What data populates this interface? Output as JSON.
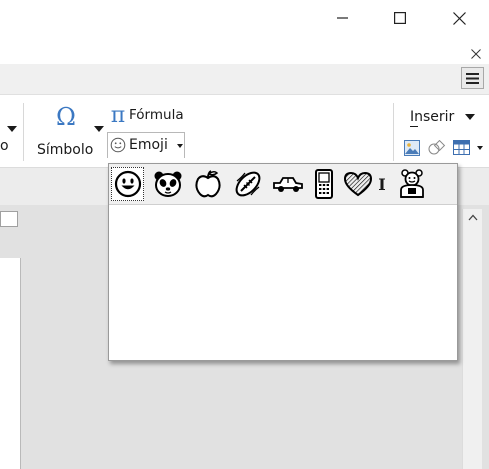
{
  "window": {
    "minimize_icon": "minimize-icon",
    "maximize_icon": "maximize-icon",
    "close_icon": "close-icon"
  },
  "infobar": {
    "close_icon": "close-icon"
  },
  "ribbon": {
    "special_char_label": "Símbolo",
    "special_char_partial_left": "o",
    "formula_label": "Fórmula",
    "emoji_label": "Emoji",
    "insert_label": "Inserir"
  },
  "emoji_tabs": [
    {
      "name": "smiley",
      "selected": true
    },
    {
      "name": "animal"
    },
    {
      "name": "food"
    },
    {
      "name": "activity"
    },
    {
      "name": "travel"
    },
    {
      "name": "objects"
    },
    {
      "name": "symbols"
    },
    {
      "name": "flags"
    },
    {
      "name": "unicode9"
    }
  ],
  "emoji_tab_flags_glyph": "I",
  "colors": {
    "accent_blue": "#3b78c2",
    "ribbon_bg": "#ffffff",
    "workspace_bg": "#e1e1e1"
  }
}
